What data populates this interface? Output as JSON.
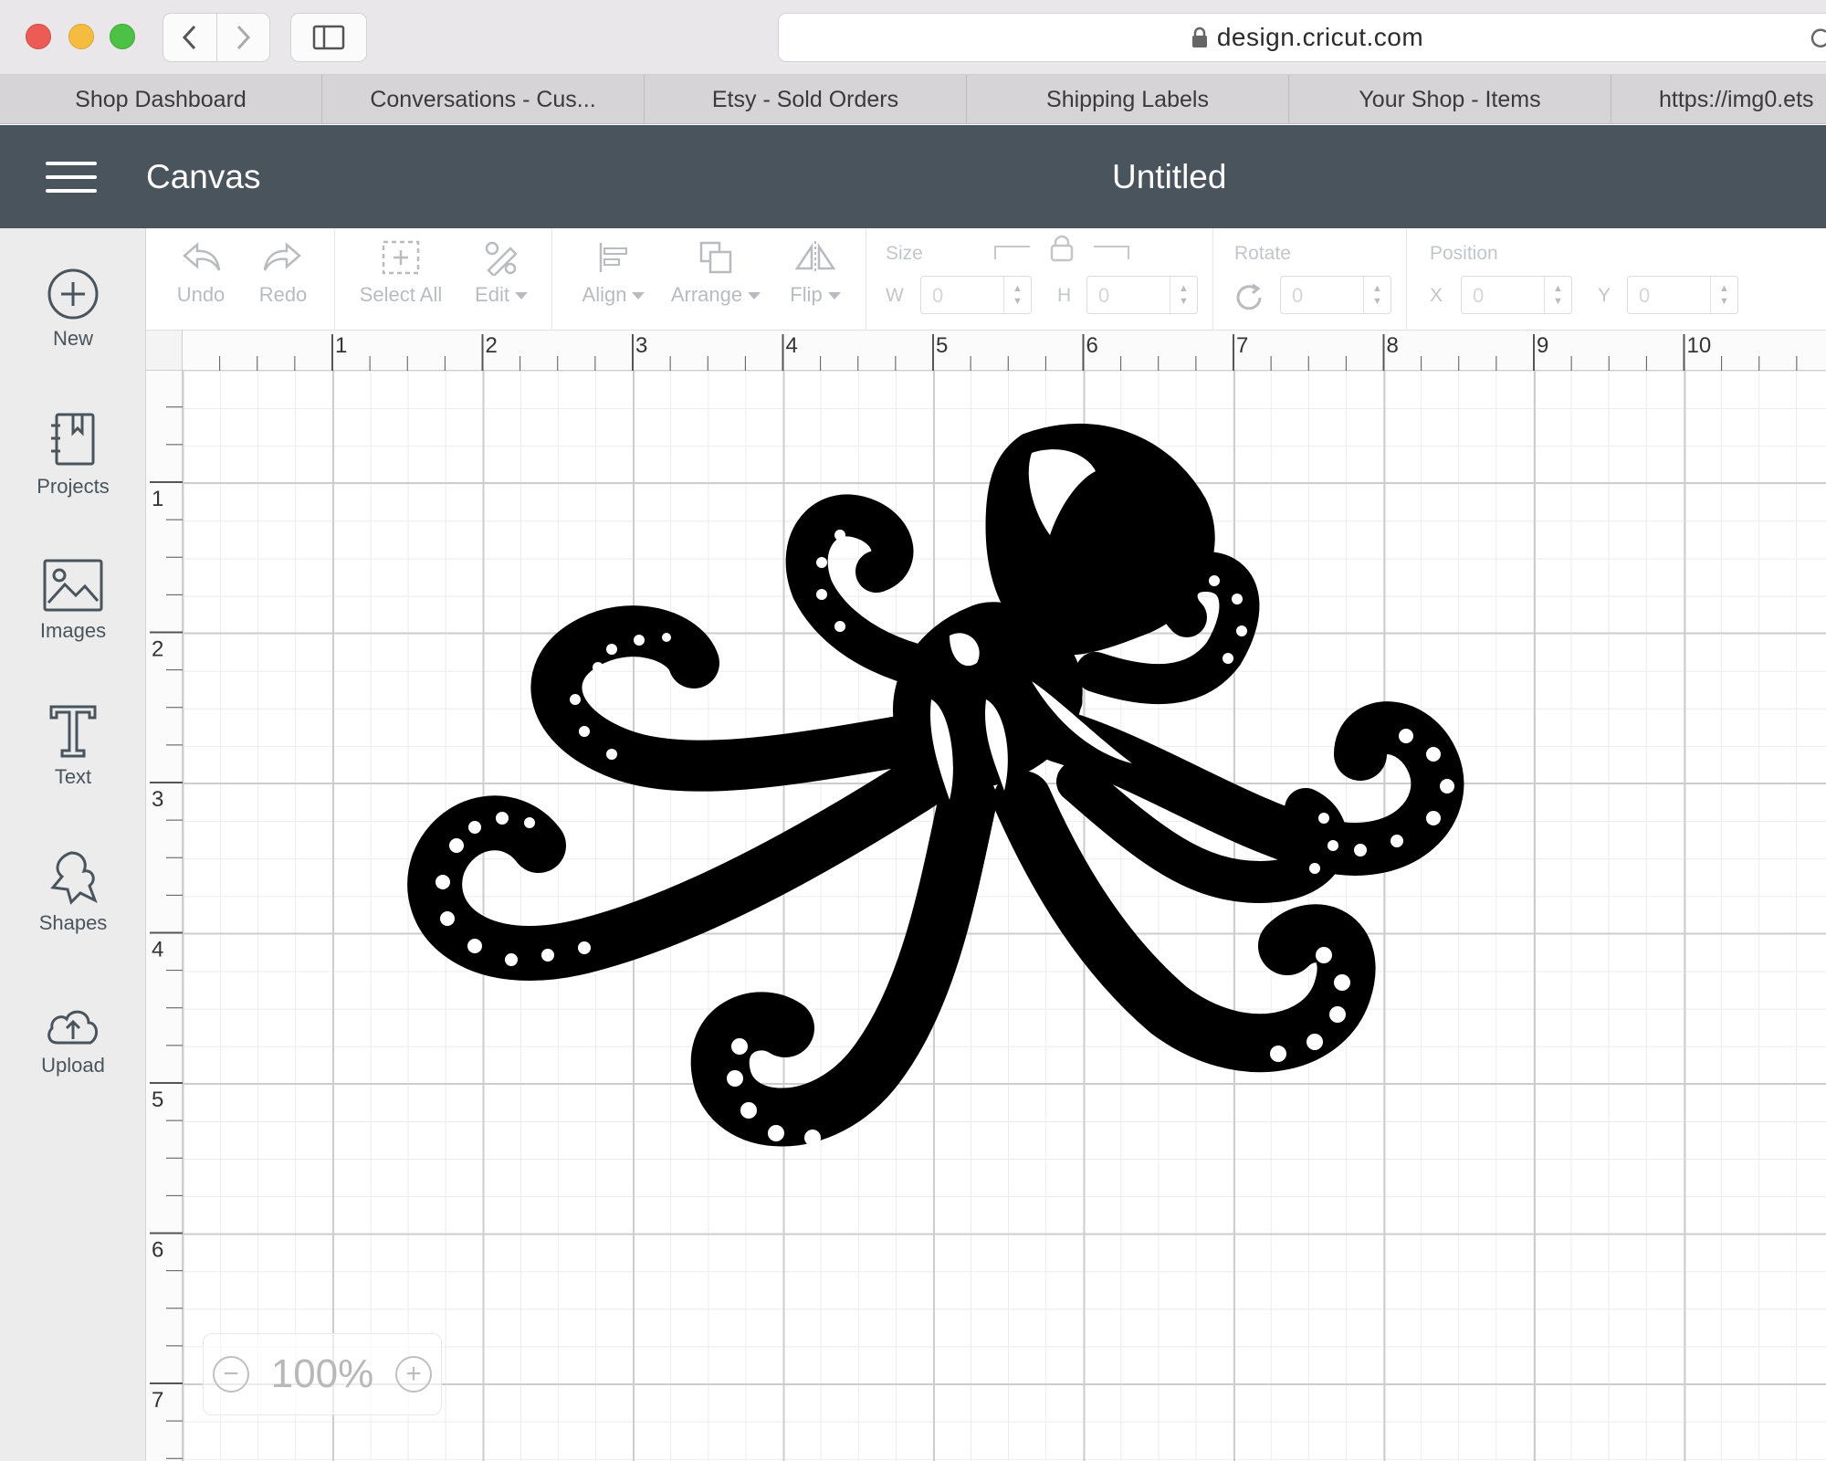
{
  "browser": {
    "url": "design.cricut.com",
    "bookmarks": [
      "Shop Dashboard",
      "Conversations - Cus...",
      "Etsy - Sold Orders",
      "Shipping Labels",
      "Your Shop - Items",
      "https://img0.ets"
    ]
  },
  "header": {
    "app_title": "Canvas",
    "doc_title": "Untitled"
  },
  "left_panel": {
    "items": [
      {
        "label": "New",
        "icon": "plus-circle-icon"
      },
      {
        "label": "Projects",
        "icon": "notebook-icon"
      },
      {
        "label": "Images",
        "icon": "image-icon"
      },
      {
        "label": "Text",
        "icon": "text-t-icon"
      },
      {
        "label": "Shapes",
        "icon": "shapes-icon"
      },
      {
        "label": "Upload",
        "icon": "cloud-upload-icon"
      }
    ]
  },
  "toolbar": {
    "undo": "Undo",
    "redo": "Redo",
    "select_all": "Select All",
    "edit": "Edit",
    "align": "Align",
    "arrange": "Arrange",
    "flip": "Flip",
    "size_label": "Size",
    "w_label": "W",
    "h_label": "H",
    "w_value": "0",
    "h_value": "0",
    "rotate_label": "Rotate",
    "rotate_value": "0",
    "position_label": "Position",
    "x_label": "X",
    "y_label": "Y",
    "x_value": "0",
    "y_value": "0"
  },
  "rulers": {
    "top": [
      "1",
      "2",
      "3",
      "4",
      "5",
      "6",
      "7",
      "8",
      "9",
      "10"
    ],
    "left": [
      "1",
      "2",
      "3",
      "4",
      "5",
      "6",
      "7"
    ]
  },
  "canvas": {
    "image": "octopus-silhouette",
    "zoom": "100%"
  }
}
